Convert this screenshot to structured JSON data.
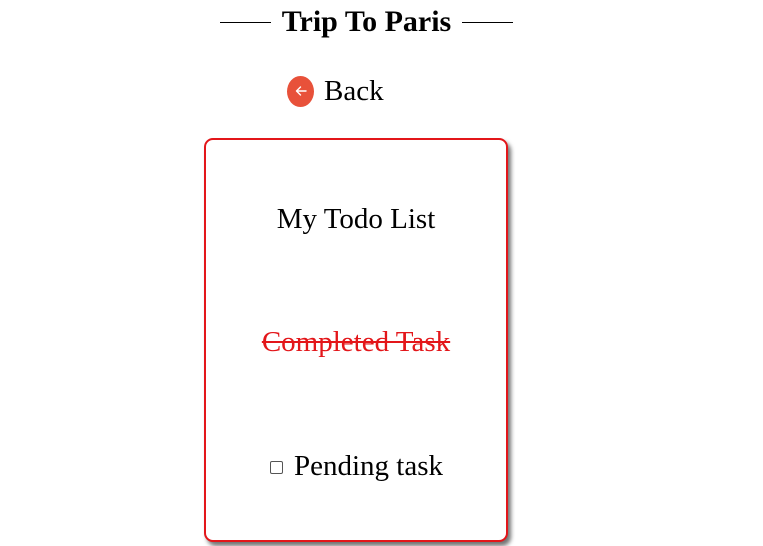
{
  "header": {
    "title": "Trip To Paris"
  },
  "nav": {
    "back_label": "Back",
    "back_icon": "arrow-left-circle-icon",
    "back_icon_color": "#e8513a"
  },
  "todo": {
    "title": "My Todo List",
    "accent_color": "#e3161a",
    "tasks": [
      {
        "label": "Completed Task",
        "completed": true
      },
      {
        "label": "Pending task",
        "completed": false
      }
    ]
  }
}
